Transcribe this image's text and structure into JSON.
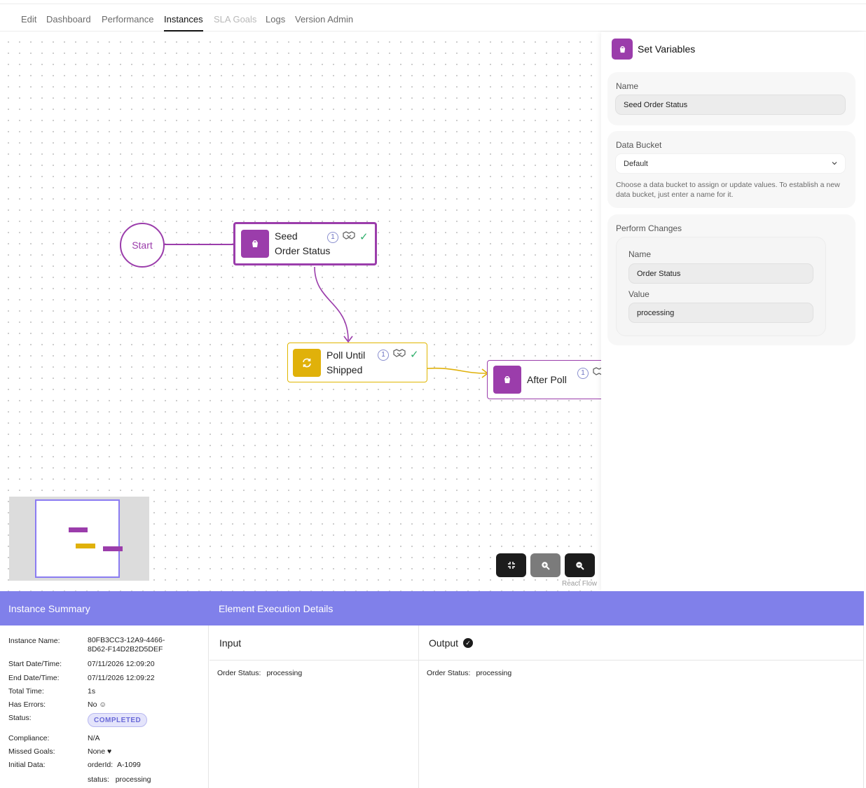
{
  "tabs": [
    {
      "label": "Edit"
    },
    {
      "label": "Dashboard"
    },
    {
      "label": "Performance"
    },
    {
      "label": "Instances"
    },
    {
      "label": "SLA Goals"
    },
    {
      "label": "Logs"
    },
    {
      "label": "Version Admin"
    }
  ],
  "active_tab": "Instances",
  "flow": {
    "start_label": "Start",
    "nodes": [
      {
        "label_line1": "Seed",
        "label_line2": "Order Status",
        "count": "1",
        "icon": "bucket-icon",
        "status": "check-icon"
      },
      {
        "label_line1": "Poll Until",
        "label_line2": "Shipped",
        "count": "1",
        "icon": "refresh-icon",
        "status": "check-icon"
      },
      {
        "label_line1": "After Poll",
        "label_line2": "",
        "count": "1",
        "icon": "bucket-icon"
      }
    ],
    "attribution": "React Flow"
  },
  "panel": {
    "title": "Set Variables",
    "name_label": "Name",
    "name_value": "Seed Order Status",
    "bucket_label": "Data Bucket",
    "bucket_value": "Default",
    "bucket_hint": "Choose a data bucket to assign or update values. To establish a new data bucket, just enter a name for it.",
    "changes_label": "Perform Changes",
    "change_name_label": "Name",
    "change_name_value": "Order Status",
    "change_value_label": "Value",
    "change_value_value": "processing"
  },
  "bottom": {
    "summary_title": "Instance Summary",
    "details_title": "Element Execution Details",
    "summary": {
      "instance_name_label": "Instance Name:",
      "instance_name_line1": "80FB3CC3-12A9-4466-",
      "instance_name_line2": "8D62-F14D2B2D5DEF",
      "start_label": "Start Date/Time:",
      "start_value": "07/11/2026 12:09:20",
      "end_label": "End Date/Time:",
      "end_value": "07/11/2026 12:09:22",
      "total_label": "Total Time:",
      "total_value": "1s",
      "errors_label": "Has Errors:",
      "errors_value": "No",
      "status_label": "Status:",
      "status_value": "COMPLETED",
      "compliance_label": "Compliance:",
      "compliance_value": "N/A",
      "missed_label": "Missed Goals:",
      "missed_value": "None",
      "initial_label": "Initial Data:",
      "initial_k1": "orderId:",
      "initial_v1": "A-1099",
      "initial_k2": "status:",
      "initial_v2": "processing"
    },
    "input": {
      "title": "Input",
      "key": "Order Status:",
      "value": "processing"
    },
    "output": {
      "title": "Output",
      "key": "Order Status:",
      "value": "processing"
    }
  },
  "colors": {
    "accent_purple": "#9b3dab",
    "accent_yellow": "#e0b10a",
    "bar_blue": "#8080ea",
    "success_green": "#2fae6b"
  }
}
